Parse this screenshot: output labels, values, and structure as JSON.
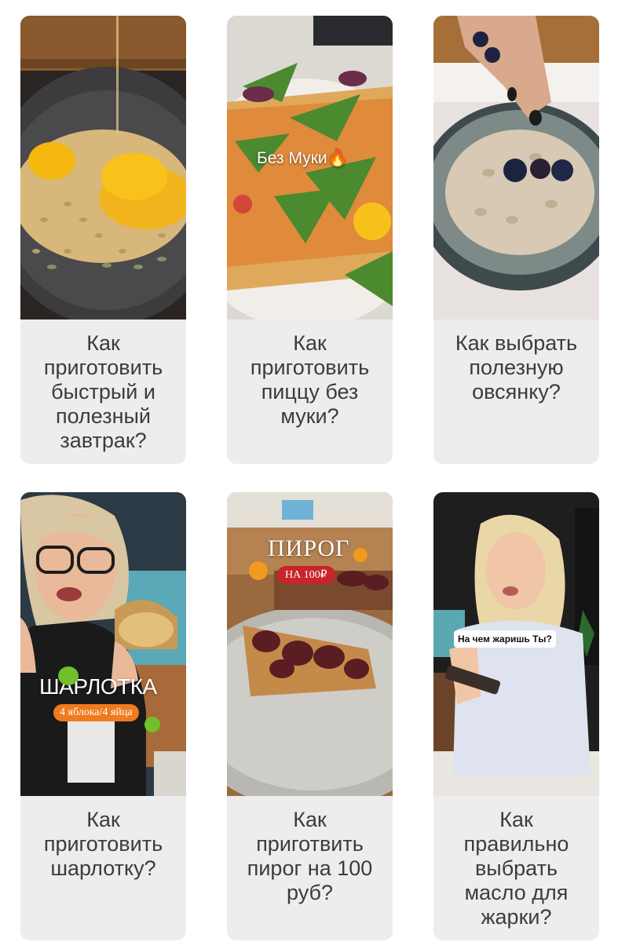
{
  "cards": [
    {
      "caption_lines": [
        "Как",
        "приготовить",
        "быстрый и",
        "полезный",
        "завтрак?"
      ],
      "overlay": null
    },
    {
      "caption_lines": [
        "Как",
        "приготовить",
        "пиццу без",
        "муки?"
      ],
      "overlay": {
        "text": "Без Муки",
        "emoji": "🔥"
      }
    },
    {
      "caption_lines": [
        "Как выбрать",
        "полезную",
        "овсянку?"
      ],
      "overlay": null
    },
    {
      "caption_lines": [
        "Как",
        "приготовить",
        "шарлотку?"
      ],
      "overlay": {
        "title": "ШАРЛОТКА",
        "badge": "4 яблока/4 яйца"
      }
    },
    {
      "caption_lines": [
        "Как",
        "приготвить",
        "пирог на 100",
        "руб?"
      ],
      "overlay": {
        "title": "ПИРОГ",
        "badge": "НА 100₽"
      }
    },
    {
      "caption_lines": [
        "Как",
        "правильно",
        "выбрать",
        "масло для",
        "жарки?"
      ],
      "overlay": {
        "bubble": "На чем жаришь Ты?"
      }
    }
  ],
  "colors": {
    "card_bg": "#ededed",
    "caption_text": "#3c3c3c",
    "orange_badge": "#f07a1e",
    "red_badge": "#c8242a"
  }
}
